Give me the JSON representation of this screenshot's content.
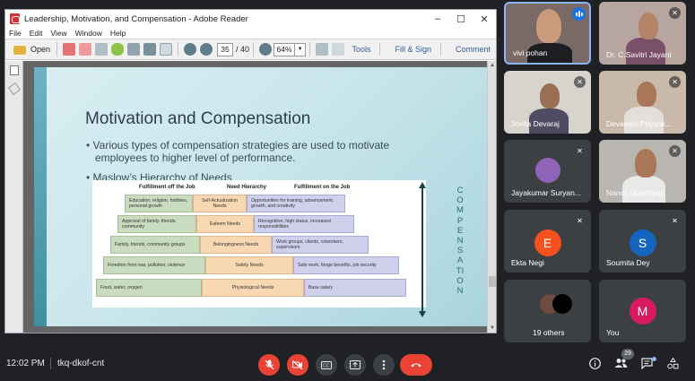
{
  "reader": {
    "title": "Leadership, Motivation, and Compensation - Adobe Reader",
    "window_controls": [
      "–",
      "☐",
      "✕"
    ],
    "menu": [
      "File",
      "Edit",
      "View",
      "Window",
      "Help"
    ],
    "toolbar": {
      "open_label": "Open",
      "page_current": "35",
      "page_total": "/ 40",
      "zoom": "64%",
      "zoom_dropdown": "▼",
      "tools_label": "Tools",
      "fill_sign_label": "Fill & Sign",
      "comment_label": "Comment"
    }
  },
  "slide": {
    "title": "Motivation and Compensation",
    "bullet1_line1": "• Various types of compensation strategies are used to motivate",
    "bullet1_line2": "employees to higher level of performance.",
    "bullet2": "• Maslow’s Hierarchy of Needs",
    "headers": {
      "off_job": "Fulfillment off the Job",
      "need": "Need Hierarchy",
      "on_job": "Fulfillment on the Job"
    },
    "rows": [
      {
        "off": "Education, religion, hobbies, personal growth",
        "need": "Self-Actualization Needs",
        "on": "Opportunities for training, advancement, growth, and creativity"
      },
      {
        "off": "Approval of family, friends, community",
        "need": "Esteem Needs",
        "on": "Recognition, high status, increased responsibilities"
      },
      {
        "off": "Family, friends, community groups",
        "need": "Belongingness Needs",
        "on": "Work groups, clients, coworkers, supervisors"
      },
      {
        "off": "Freedom from war, pollution, violence",
        "need": "Safety Needs",
        "on": "Safe work, fringe benefits, job security"
      },
      {
        "off": "Food, water, oxygen",
        "need": "Physiological Needs",
        "on": "Base salary"
      }
    ],
    "vertical_label": "COMPENSATION"
  },
  "participants": [
    {
      "name": "vivi pohan",
      "speaking": true
    },
    {
      "name": "Dr. C.Savitri Jayant"
    },
    {
      "name": "Jovita Devaraj"
    },
    {
      "name": "Devasani Priyank..."
    },
    {
      "name": "Jayakumar Suryan..."
    },
    {
      "name": "Nancy Upadhyay"
    },
    {
      "name": "Ekta Negi",
      "initial": "E",
      "color": "#f4511e"
    },
    {
      "name": "Soumita Dey",
      "initial": "S",
      "color": "#1565c0"
    },
    {
      "name": "19 others"
    },
    {
      "name": "You",
      "initial": "M",
      "color": "#d81b60"
    }
  ],
  "meeting": {
    "time": "12:02 PM",
    "code": "tkq-dkof-cnt",
    "participant_count": "29"
  },
  "icons": {
    "mic_off": "mic-off-icon",
    "cam_off": "camera-off-icon",
    "captions": "captions-icon",
    "present": "present-icon",
    "more": "more-vert-icon",
    "hangup": "call-end-icon",
    "info": "info-icon",
    "people": "people-icon",
    "chat": "chat-icon",
    "activities": "activities-icon"
  }
}
